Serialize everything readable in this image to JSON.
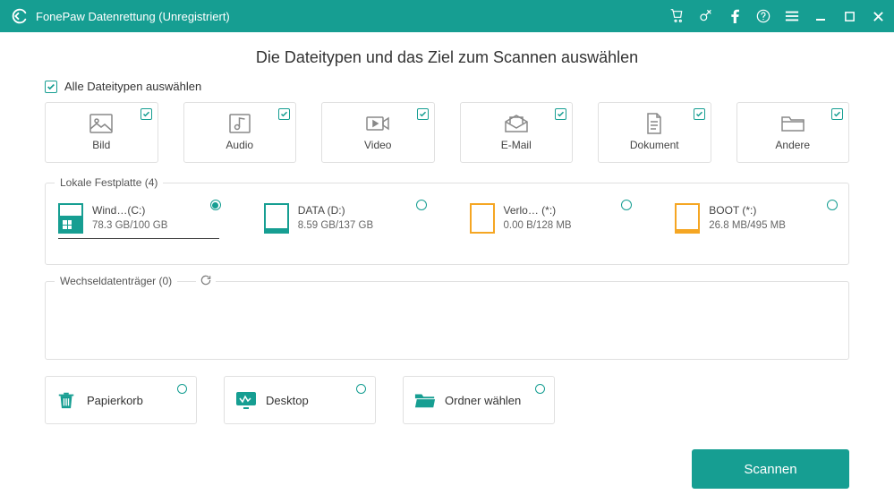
{
  "app": {
    "title": "FonePaw Datenrettung (Unregistriert)"
  },
  "heading": "Die Dateitypen und das Ziel zum Scannen auswählen",
  "select_all_label": "Alle Dateitypen auswählen",
  "types": [
    {
      "label": "Bild"
    },
    {
      "label": "Audio"
    },
    {
      "label": "Video"
    },
    {
      "label": "E-Mail"
    },
    {
      "label": "Dokument"
    },
    {
      "label": "Andere"
    }
  ],
  "local_drives": {
    "label": "Lokale Festplatte (4)",
    "items": [
      {
        "name": "Wind…(C:)",
        "size": "78.3 GB/100 GB",
        "color": "#169e92",
        "fill_pct": 60,
        "selected": true,
        "win_icon": true
      },
      {
        "name": "DATA (D:)",
        "size": "8.59 GB/137 GB",
        "color": "#169e92",
        "fill_pct": 12,
        "selected": false
      },
      {
        "name": "Verlo… (*:)",
        "size": "0.00  B/128 MB",
        "color": "#f5a623",
        "fill_pct": 0,
        "selected": false
      },
      {
        "name": "BOOT (*:)",
        "size": "26.8 MB/495 MB",
        "color": "#f5a623",
        "fill_pct": 10,
        "selected": false
      }
    ]
  },
  "removable": {
    "label": "Wechseldatenträger (0)"
  },
  "locations": [
    {
      "label": "Papierkorb"
    },
    {
      "label": "Desktop"
    },
    {
      "label": "Ordner wählen"
    }
  ],
  "scan_button": "Scannen",
  "colors": {
    "accent": "#169e92"
  }
}
